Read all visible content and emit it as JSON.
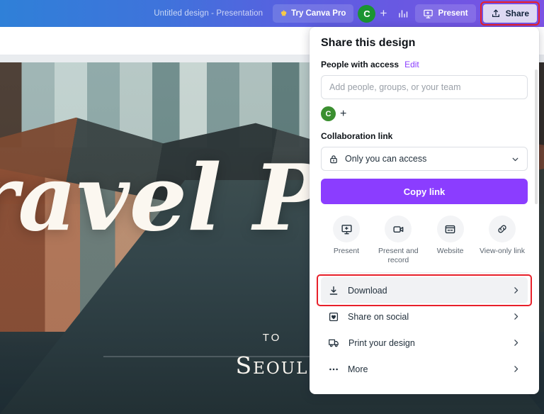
{
  "appbar": {
    "doc_title": "Untitled design - Presentation",
    "try_pro_label": "Try Canva Pro",
    "avatar_initial": "C",
    "plus_label": "+",
    "present_label": "Present",
    "share_label": "Share",
    "icons": {
      "crown": "crown-icon",
      "chart": "chart-icon",
      "present": "present-screen-icon",
      "share": "share-upload-icon"
    },
    "highlight_color": "#e8202a",
    "gradient_from": "#2f80d8",
    "gradient_to": "#7b52e4"
  },
  "canvas": {
    "title": "Travel Plan",
    "to_label": "TO",
    "destination": "Seoul"
  },
  "panel": {
    "title": "Share this design",
    "people_label": "People with access",
    "edit_label": "Edit",
    "edit_color": "#8b3dff",
    "search_placeholder": "Add people, groups, or your team",
    "people": [
      {
        "initial": "C",
        "color": "#3b8f30"
      }
    ],
    "add_person_label": "+",
    "collab_label": "Collaboration link",
    "access_value": "Only you can access",
    "access_icon": "lock-icon",
    "copy_link_label": "Copy link",
    "copy_link_color": "#8b3dff",
    "quick_actions": [
      {
        "label": "Present",
        "icon": "present-screen-icon"
      },
      {
        "label": "Present and record",
        "icon": "video-camera-icon"
      },
      {
        "label": "Website",
        "icon": "website-icon"
      },
      {
        "label": "View-only link",
        "icon": "link-icon"
      }
    ],
    "menu_items": [
      {
        "label": "Download",
        "icon": "download-icon",
        "highlighted": true
      },
      {
        "label": "Share on social",
        "icon": "social-heart-icon",
        "highlighted": false
      },
      {
        "label": "Print your design",
        "icon": "delivery-truck-icon",
        "highlighted": false
      },
      {
        "label": "More",
        "icon": "ellipsis-icon",
        "highlighted": false
      }
    ]
  }
}
